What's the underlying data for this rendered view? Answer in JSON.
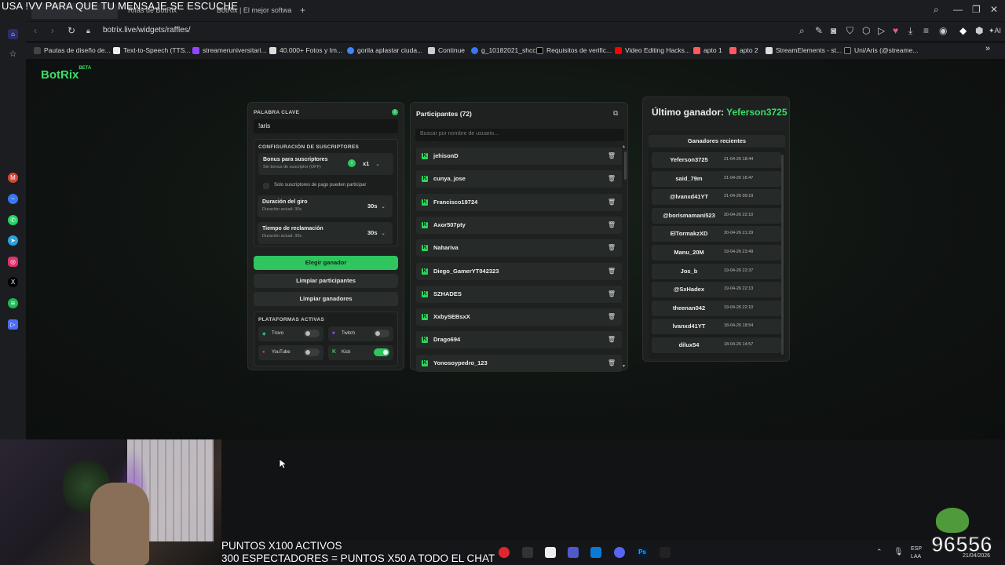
{
  "overlay_top": "USA !VV PARA QUE TU MENSAJE SE ESCUCHE",
  "tabs": [
    {
      "label": ""
    },
    {
      "label": "Rifas de BotRix"
    },
    {
      "label": "BotRix | El mejor software"
    }
  ],
  "address": {
    "url": "botrix.live/widgets/raffles/"
  },
  "bookmarks": [
    {
      "label": "Pautas de diseño de..."
    },
    {
      "label": "Text-to-Speech (TTS..."
    },
    {
      "label": "streameruniversitari..."
    },
    {
      "label": "40.000+ Fotos y Im..."
    },
    {
      "label": "gorila aplastar ciuda..."
    },
    {
      "label": "Continue"
    },
    {
      "label": "g_10182021_shcc"
    },
    {
      "label": "Requisitos de verific..."
    },
    {
      "label": "Video Editing Hacks..."
    },
    {
      "label": "apto 1"
    },
    {
      "label": "apto 2"
    },
    {
      "label": "StreamElements - st..."
    },
    {
      "label": "Uni/Aris (@streame..."
    }
  ],
  "logo": {
    "text": "BotRix",
    "badge": "BETA"
  },
  "settings": {
    "keyword_label": "PALABRA CLAVE",
    "keyword_value": "!aris",
    "subs_section": "CONFIGURACIÓN DE SUSCRIPTORES",
    "bonus_title": "Bonus para suscriptores",
    "bonus_sub": "Sin bonus de suscriptor (OFF)",
    "bonus_value": "x1",
    "subs_only": "Solo suscriptores de pago pueden participar",
    "spin_title": "Duración del giro",
    "spin_sub": "Duración actual: 30s",
    "spin_value": "30s",
    "claim_title": "Tiempo de reclamación",
    "claim_sub": "Duración actual: 30s",
    "claim_value": "30s",
    "pick_winner": "Elegir ganador",
    "clear_participants": "Limpiar participantes",
    "clear_winners": "Limpiar ganadores",
    "platforms_label": "PLATAFORMAS ACTIVAS",
    "platforms": [
      {
        "name": "Trovo",
        "on": false
      },
      {
        "name": "Twitch",
        "on": false
      },
      {
        "name": "YouTube",
        "on": false
      },
      {
        "name": "Kick",
        "on": true
      }
    ]
  },
  "participants": {
    "title": "Participantes (72)",
    "search_placeholder": "Buscar por nombre de usuario...",
    "items": [
      "jehisonD",
      "cunya_jose",
      "Francisco19724",
      "Axor507pty",
      "Nahariva",
      "Diego_GamerYT042323",
      "SZHADES",
      "XxbySEBsxX",
      "Drago694",
      "Yonosoypedro_123"
    ]
  },
  "winners": {
    "last_label": "Último ganador:",
    "last_name": "Yeferson3725",
    "recent_title": "Ganadores recientes",
    "items": [
      {
        "name": "Yeferson3725",
        "date": "21-04-26 18:44"
      },
      {
        "name": "said_79m",
        "date": "21-04-26 16:47"
      },
      {
        "name": "@lvanxd41YT",
        "date": "21-04-26 00:19"
      },
      {
        "name": "@borismamani523",
        "date": "20-04-26 22:10"
      },
      {
        "name": "ElTormakzXD",
        "date": "20-04-26 21:29"
      },
      {
        "name": "Manu_20M",
        "date": "19-04-26 23:49"
      },
      {
        "name": "Jos_b",
        "date": "19-04-26 22:37"
      },
      {
        "name": "@SxHadex",
        "date": "19-04-26 22:13"
      },
      {
        "name": "theenan042",
        "date": "19-04-26 22:10"
      },
      {
        "name": "lvanxd41YT",
        "date": "18-04-26 18:54"
      },
      {
        "name": "dilux54",
        "date": "18-04-26 14:57"
      }
    ]
  },
  "stream_overlay": {
    "line1": "PUNTOS X100 ACTIVOS",
    "line2": "300 ESPECTADORES = PUNTOS X50 A TODO EL CHAT",
    "counter": "96556"
  },
  "taskbar": {
    "lang1": "ESP",
    "lang2": "LAA",
    "date": "21/04/2026"
  }
}
